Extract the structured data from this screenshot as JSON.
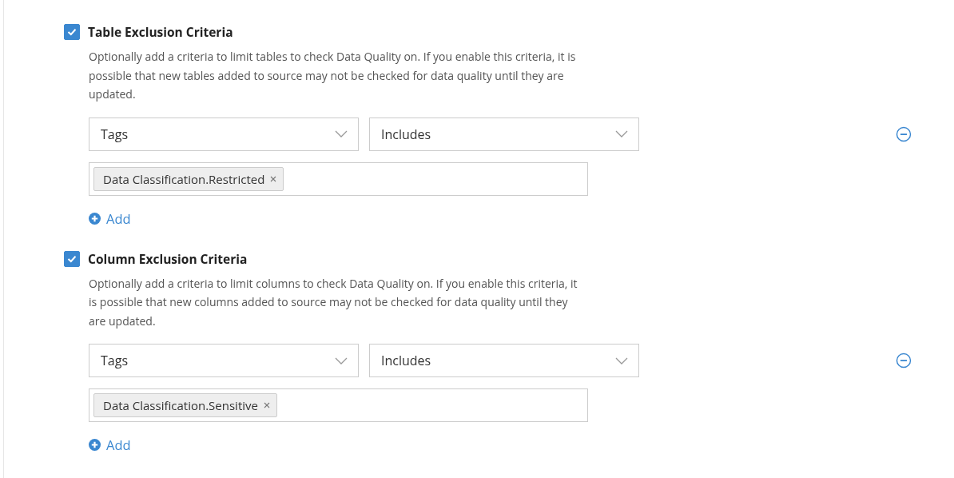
{
  "sections": [
    {
      "title": "Table Exclusion Criteria",
      "checked": true,
      "description": "Optionally add a criteria to limit tables to check Data Quality on. If you enable this criteria, it is possible that new tables added to source may not be checked for data quality until they are updated.",
      "field": "Tags",
      "operator": "Includes",
      "tags": [
        "Data Classification.Restricted"
      ],
      "add_label": "Add"
    },
    {
      "title": "Column Exclusion Criteria",
      "checked": true,
      "description": "Optionally add a criteria to limit columns to check Data Quality on. If you enable this criteria, it is possible that new columns added to source may not be checked for data quality until they are updated.",
      "field": "Tags",
      "operator": "Includes",
      "tags": [
        "Data Classification.Sensitive"
      ],
      "add_label": "Add"
    }
  ]
}
